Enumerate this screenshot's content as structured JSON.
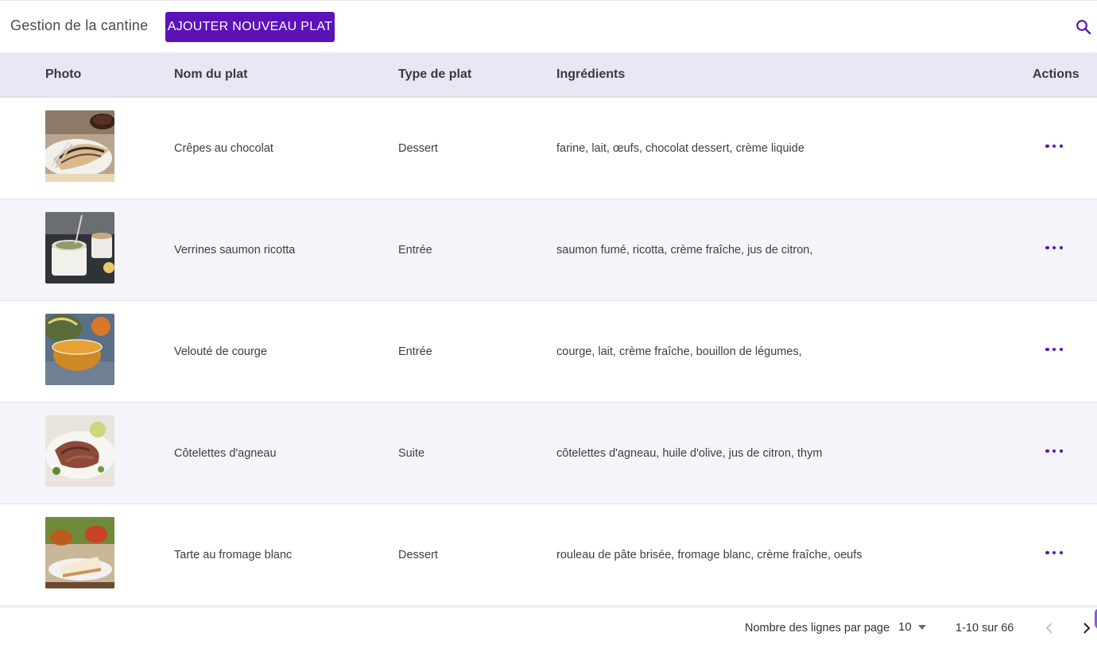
{
  "header": {
    "title": "Gestion de la cantine",
    "add_button": "AJOUTER NOUVEAU PLAT"
  },
  "table": {
    "columns": [
      "Photo",
      "Nom du plat",
      "Type de plat",
      "Ingrédients",
      "Actions"
    ],
    "rows": [
      {
        "name": "Crêpes au chocolat",
        "type": "Dessert",
        "ingredients": "farine, lait, œufs, chocolat dessert, crème liquide"
      },
      {
        "name": "Verrines saumon ricotta",
        "type": "Entrée",
        "ingredients": "saumon fumé, ricotta, crème fraîche, jus de citron,"
      },
      {
        "name": "Velouté de courge",
        "type": "Entrée",
        "ingredients": "courge, lait, crème fraîche, bouillon de légumes,"
      },
      {
        "name": "Côtelettes d'agneau",
        "type": "Suite",
        "ingredients": "côtelettes d'agneau, huile d'olive, jus de citron, thym"
      },
      {
        "name": "Tarte au fromage blanc",
        "type": "Dessert",
        "ingredients": "rouleau de pâte brisée, fromage blanc, crème fraîche, oeufs"
      }
    ]
  },
  "pagination": {
    "rows_per_page_label": "Nombre des lignes par page",
    "rows_per_page_value": "10",
    "range": "1-10 sur 66"
  },
  "colors": {
    "accent": "#5b12b8",
    "header_bg": "#e8e8f4",
    "row_alt_bg": "#f5f4fb"
  },
  "icons": {
    "search": "search-icon",
    "actions": "more-horizontal-icon",
    "select": "caret-down-icon",
    "prev": "chevron-left-icon",
    "next": "chevron-right-icon"
  }
}
